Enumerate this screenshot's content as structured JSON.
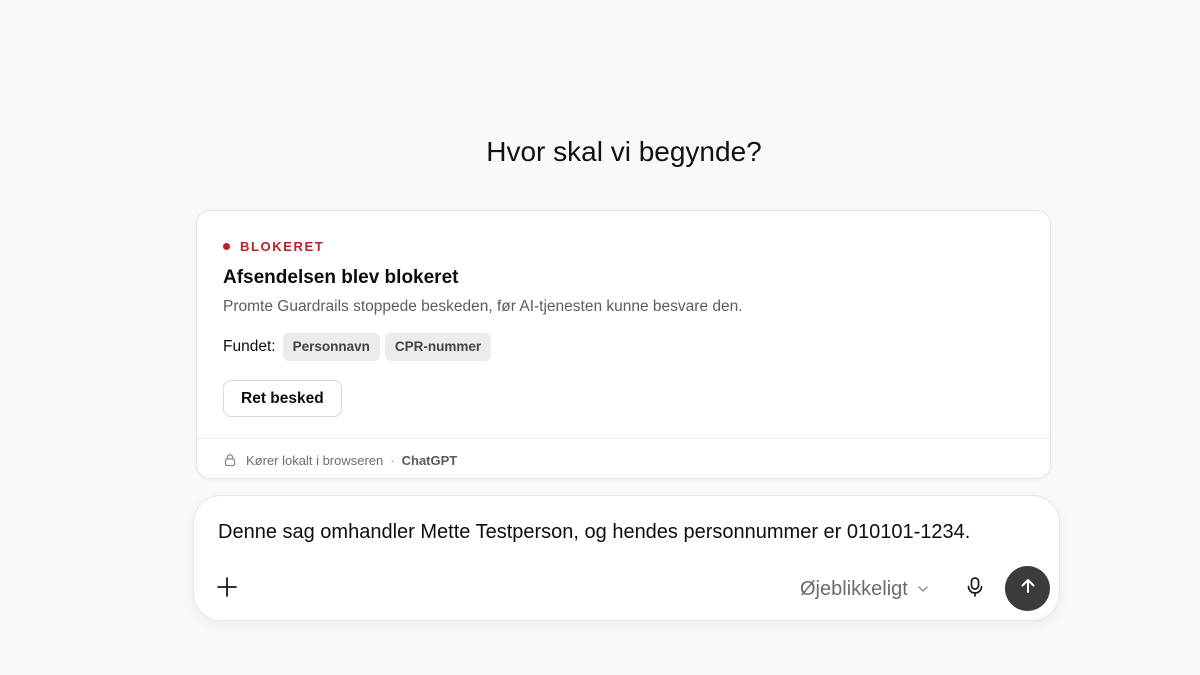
{
  "heading": "Hvor skal vi begynde?",
  "alert": {
    "status": "BLOKERET",
    "status_color": "#b4232a",
    "title": "Afsendelsen blev blokeret",
    "description": "Promte Guardrails stoppede beskeden, før AI-tjenesten kunne besvare den.",
    "found_label": "Fundet:",
    "found_items": [
      "Personnavn",
      "CPR-nummer"
    ],
    "edit_button": "Ret besked",
    "footer_icon": "lock-icon",
    "footer_text": "Kører lokalt i browseren",
    "footer_separator": "·",
    "footer_brand": "ChatGPT"
  },
  "composer": {
    "message": "Denne sag omhandler Mette Testperson, og hendes personnummer er 010101-1234.",
    "add_icon": "plus-icon",
    "model_label": "Øjeblikkeligt",
    "model_icon": "chevron-down-icon",
    "mic_icon": "microphone-icon",
    "send_icon": "arrow-up-icon",
    "send_color": "#3b3b3b"
  }
}
